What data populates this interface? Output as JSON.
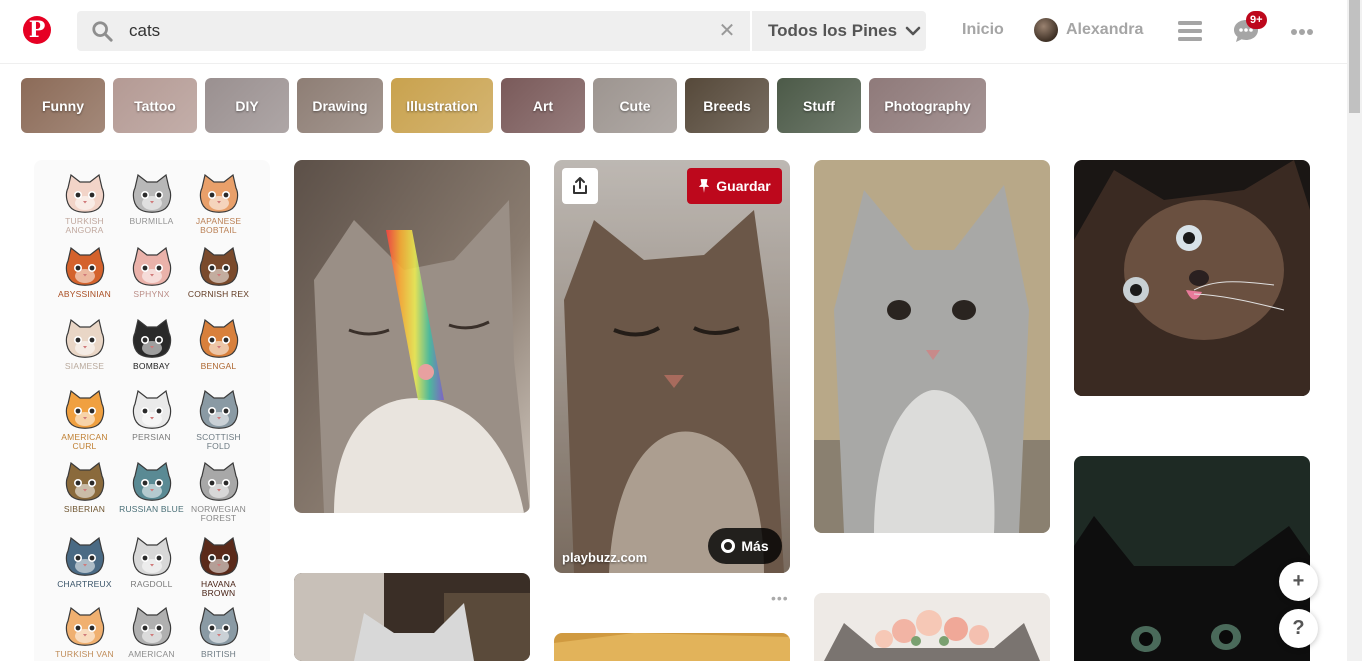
{
  "header": {
    "logo_letter": "P",
    "search": {
      "value": "cats",
      "clear": "✕"
    },
    "scope": "Todos los Pines",
    "nav_home": "Inicio",
    "user_name": "Alexandra",
    "notification_badge": "9+"
  },
  "guides": [
    {
      "label": "Funny",
      "color": "#8c6b58"
    },
    {
      "label": "Tattoo",
      "color": "#b49a94"
    },
    {
      "label": "DIY",
      "color": "#9a9090"
    },
    {
      "label": "Drawing",
      "color": "#8e7e75"
    },
    {
      "label": "Illustration",
      "color": "#c9a24e"
    },
    {
      "label": "Art",
      "color": "#7a5a5a"
    },
    {
      "label": "Cute",
      "color": "#9d9590"
    },
    {
      "label": "Breeds",
      "color": "#56493a"
    },
    {
      "label": "Stuff",
      "color": "#4c5a48"
    },
    {
      "label": "Photography",
      "color": "#8f7a7a"
    }
  ],
  "breeds": [
    {
      "name": "Turkish Angora",
      "color": "#f2d4c8"
    },
    {
      "name": "Burmilla",
      "color": "#b8b8b8"
    },
    {
      "name": "Japanese Bobtail",
      "color": "#e9a06a"
    },
    {
      "name": "Abyssinian",
      "color": "#d4622c"
    },
    {
      "name": "Sphynx",
      "color": "#eab2aa"
    },
    {
      "name": "Cornish Rex",
      "color": "#7a4a2c"
    },
    {
      "name": "Siamese",
      "color": "#e9d6c6"
    },
    {
      "name": "Bombay",
      "color": "#2a2a2a"
    },
    {
      "name": "Bengal",
      "color": "#d8803c"
    },
    {
      "name": "American Curl",
      "color": "#f0a040"
    },
    {
      "name": "Persian",
      "color": "#eaeaea"
    },
    {
      "name": "Scottish Fold",
      "color": "#8a9aa4"
    },
    {
      "name": "Siberian",
      "color": "#8a6a3c"
    },
    {
      "name": "Russian Blue",
      "color": "#5a8a94"
    },
    {
      "name": "Norwegian Forest",
      "color": "#a8a8a8"
    },
    {
      "name": "Chartreux",
      "color": "#4a6a84"
    },
    {
      "name": "Ragdoll",
      "color": "#d8d8d8"
    },
    {
      "name": "Havana Brown",
      "color": "#5a2a1a"
    },
    {
      "name": "Turkish Van",
      "color": "#f0b070"
    },
    {
      "name": "American",
      "color": "#b0b0b0"
    },
    {
      "name": "British",
      "color": "#8a9aa4"
    }
  ],
  "pin_actions": {
    "save": "Guardar",
    "source": "playbuzz.com",
    "more": "Más"
  },
  "fab": {
    "add": "+",
    "help": "?"
  }
}
